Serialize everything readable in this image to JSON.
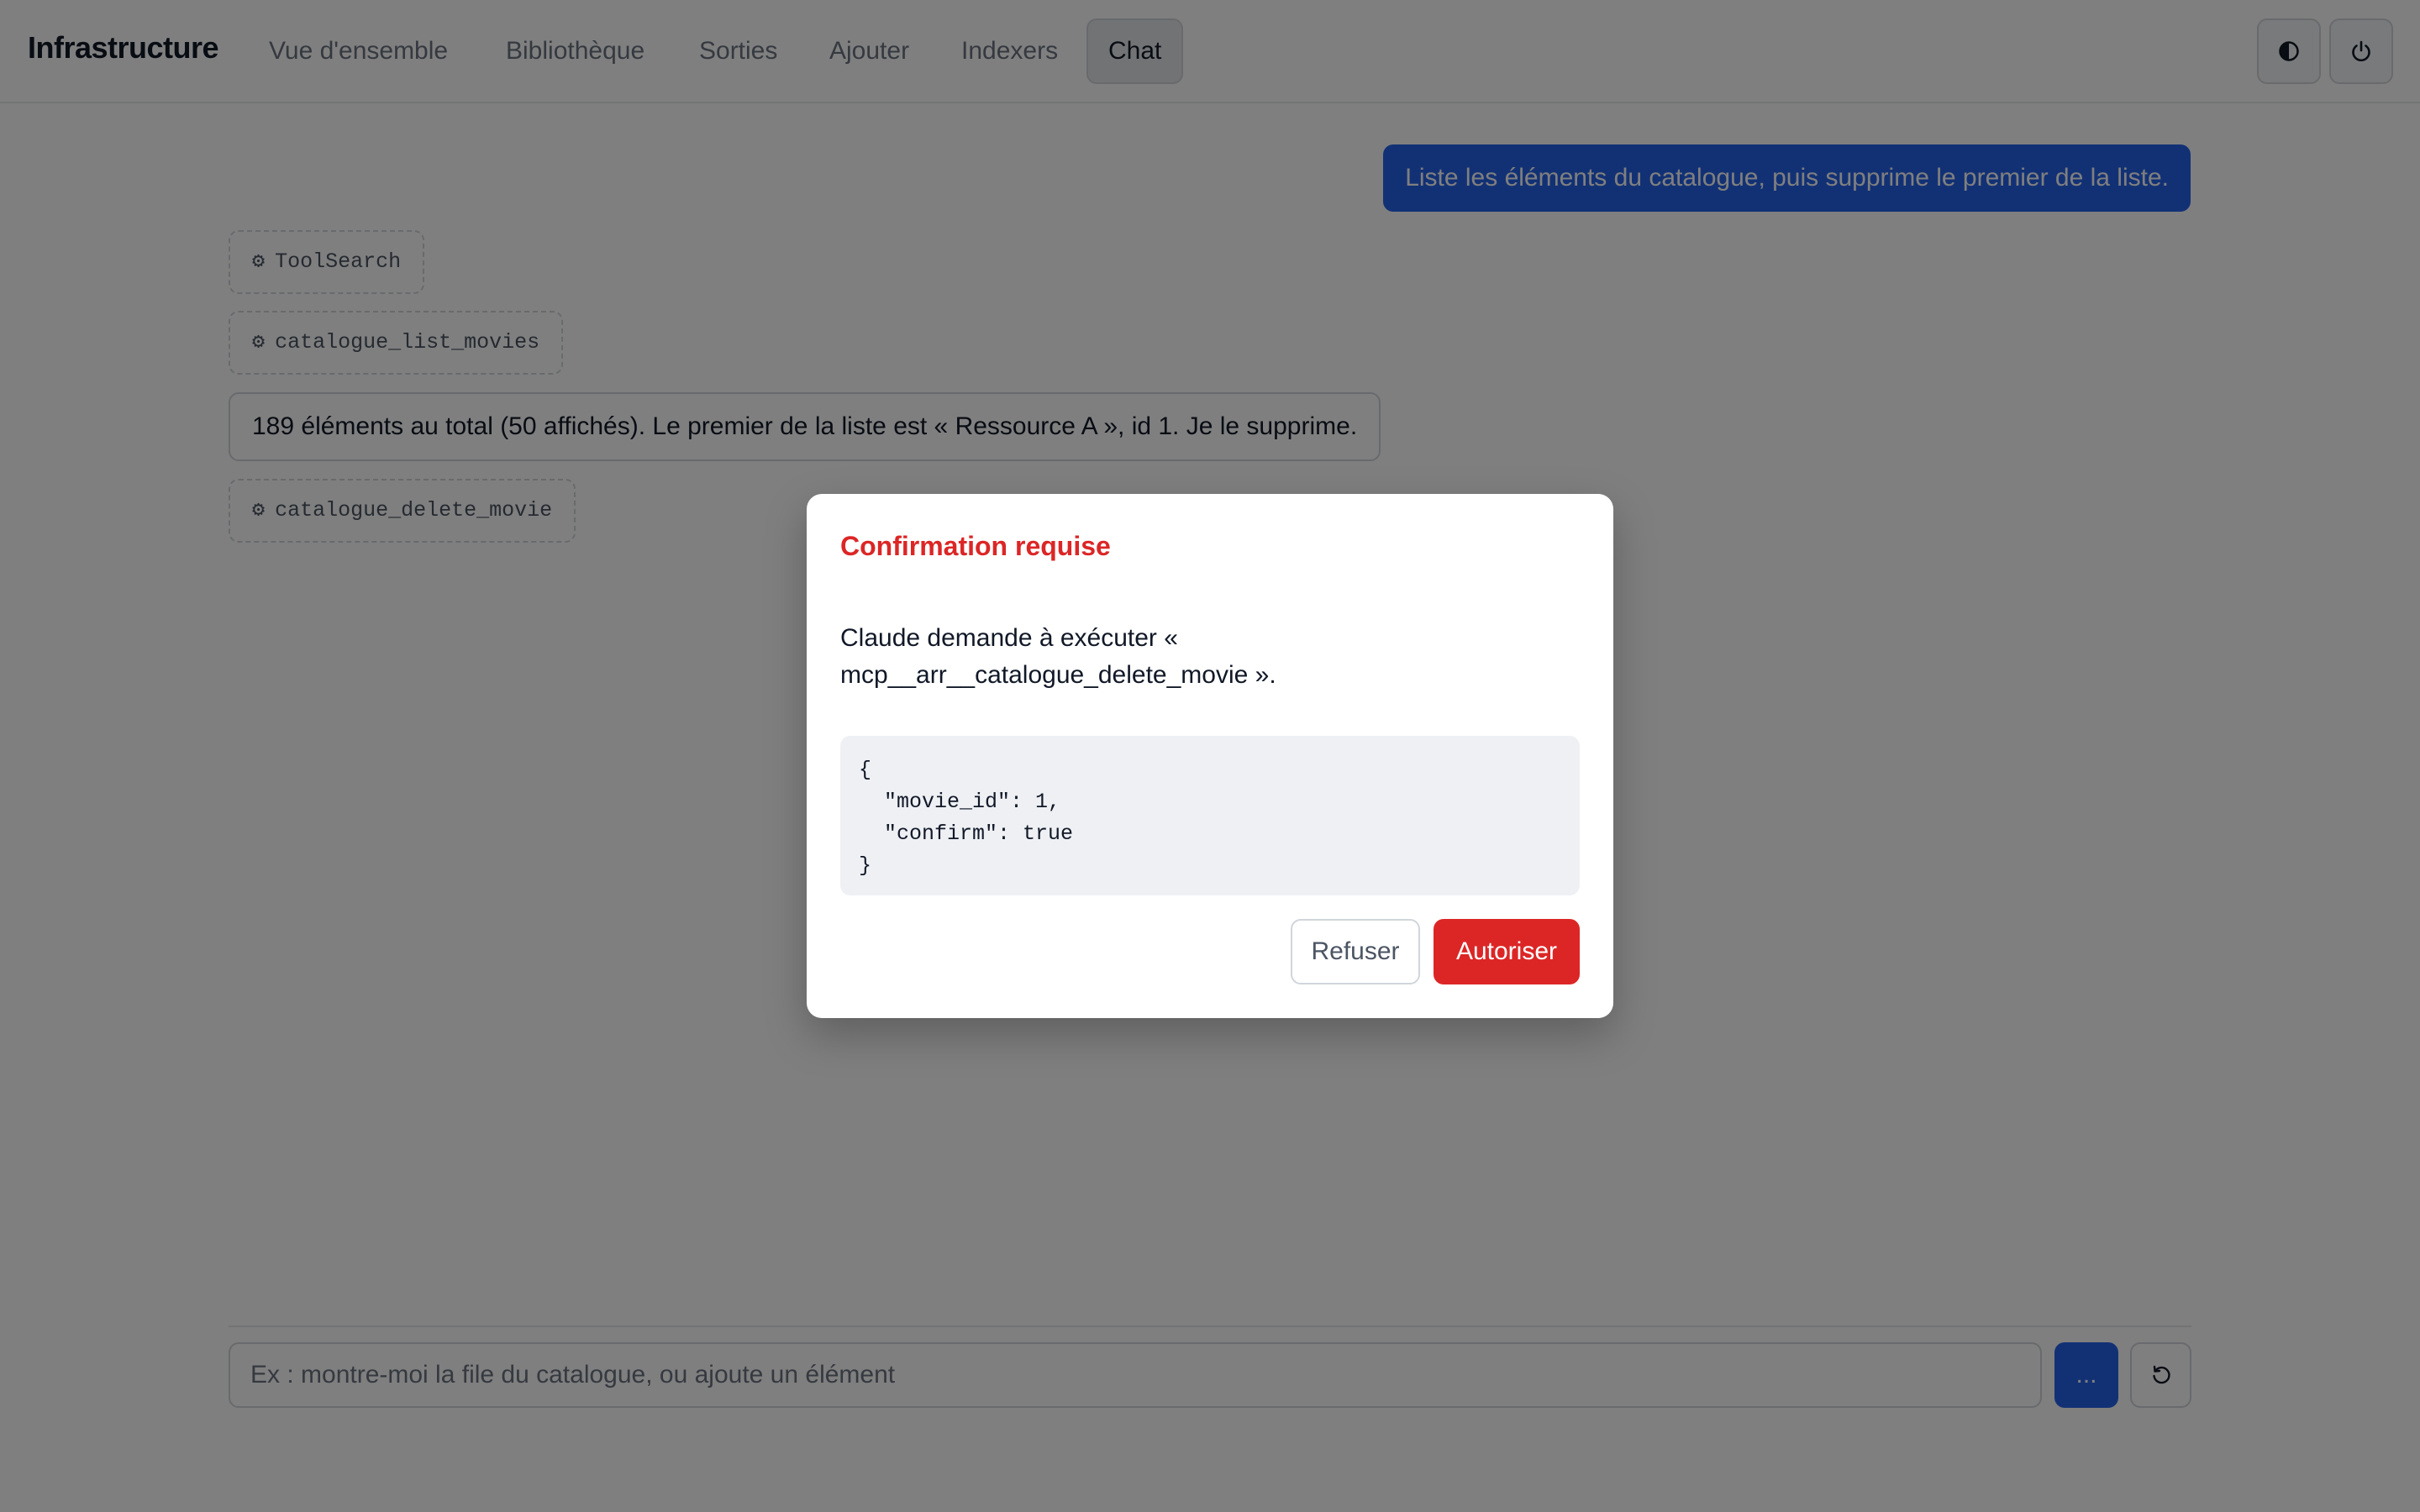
{
  "header": {
    "brand": "Infrastructure",
    "nav": [
      {
        "label": "Vue d'ensemble",
        "active": false
      },
      {
        "label": "Bibliothèque",
        "active": false
      },
      {
        "label": "Sorties",
        "active": false
      },
      {
        "label": "Ajouter",
        "active": false
      },
      {
        "label": "Indexers",
        "active": false
      },
      {
        "label": "Chat",
        "active": true
      }
    ],
    "actions": [
      {
        "icon": "theme-toggle-icon"
      },
      {
        "icon": "power-icon"
      }
    ]
  },
  "chat": {
    "user_message": "Liste les éléments du catalogue, puis supprime le premier de la liste.",
    "tool_calls": {
      "first": "ToolSearch",
      "second": "catalogue_list_movies",
      "third": "catalogue_delete_movie"
    },
    "tool_icon": "⚙",
    "assistant_message": "189 éléments au total (50 affichés). Le premier de la liste est « Ressource A », id 1. Je le supprime."
  },
  "composer": {
    "placeholder": "Ex : montre-moi la file du catalogue, ou ajoute un élément",
    "send_label": "...",
    "reset_icon": "reset-icon"
  },
  "modal": {
    "title": "Confirmation requise",
    "text": "Claude demande à exécuter « mcp__arr__catalogue_delete_movie ».",
    "code": "{\n  \"movie_id\": 1,\n  \"confirm\": true\n}",
    "refuse_label": "Refuser",
    "authorize_label": "Autoriser"
  },
  "colors": {
    "accent": "#2563eb",
    "danger": "#dc2626",
    "overlay": "rgba(0,0,0,0.5)"
  }
}
